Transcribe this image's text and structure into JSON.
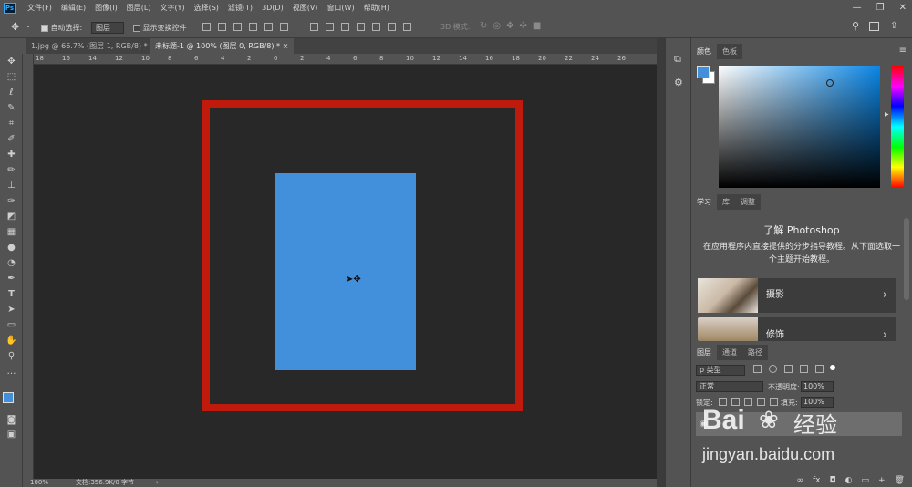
{
  "app": {
    "logo": "Ps"
  },
  "menu": [
    "文件(F)",
    "编辑(E)",
    "图像(I)",
    "图层(L)",
    "文字(Y)",
    "选择(S)",
    "滤镜(T)",
    "3D(D)",
    "视图(V)",
    "窗口(W)",
    "帮助(H)"
  ],
  "window_controls": [
    "—",
    "❐",
    "✕"
  ],
  "options": {
    "auto_select_label": "自动选择:",
    "auto_select_value": "图层",
    "show_transform_label": "显示变换控件",
    "mode_3d_label": "3D 模式:"
  },
  "tabs": [
    {
      "label": "1.jpg @ 66.7% (图层 1, RGB/8) *",
      "close": "×"
    },
    {
      "label": "未标题-1 @ 100% (图层 0, RGB/8) *",
      "close": "×"
    }
  ],
  "ruler_labels": [
    "18",
    "16",
    "14",
    "12",
    "10",
    "8",
    "6",
    "4",
    "2",
    "0",
    "2",
    "4",
    "6",
    "8",
    "10",
    "12",
    "14",
    "16",
    "18",
    "20",
    "22",
    "24",
    "26"
  ],
  "status": {
    "zoom": "100%",
    "doc": "文档:356.9K/0 字节",
    "arrow": "›"
  },
  "color_panel": {
    "tabs": [
      "颜色",
      "色板"
    ],
    "foreground": "#4290db",
    "background": "#ffffff"
  },
  "learn_panel": {
    "tabs": [
      "学习",
      "库",
      "调整"
    ],
    "title": "了解 Photoshop",
    "desc": "在应用程序内直接提供的分步指导教程。从下面选取一个主题开始教程。",
    "cards": [
      {
        "label": "摄影",
        "chev": "›"
      },
      {
        "label": "修饰",
        "chev": "›"
      }
    ]
  },
  "layers_panel": {
    "tabs": [
      "图层",
      "通道",
      "路径"
    ],
    "filter": "ρ 类型",
    "blend": "正常",
    "opacity_label": "不透明度:",
    "opacity": "100%",
    "lock_label": "锁定:",
    "fill_label": "填充:",
    "fill": "100%",
    "footer_icons": [
      "∞",
      "fx",
      "◘",
      "◐",
      "▭",
      "+",
      "🗑"
    ]
  },
  "watermark": {
    "brand": "Bai",
    "brand2": "经验",
    "url": "jingyan.baidu.com"
  },
  "colors": {
    "red_frame": "#c01a0c",
    "blue_rect": "#4290db",
    "canvas_bg": "#282828",
    "ui_bg": "#535353"
  }
}
